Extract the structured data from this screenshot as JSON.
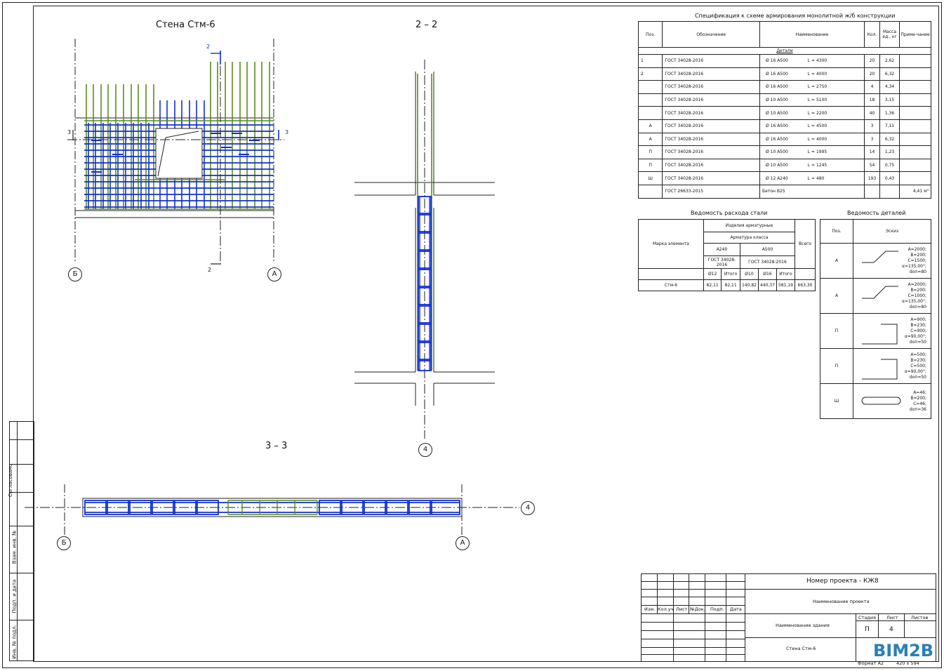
{
  "views": {
    "wall_title": "Стена Стм-6",
    "section22_title": "2 – 2",
    "section33_title": "3 – 3",
    "cut_label_2": "2",
    "cut_label_3": "3"
  },
  "axes": {
    "b": "Б",
    "a": "А",
    "four": "4"
  },
  "spec": {
    "title": "Спецификация к схеме армирования монолитной ж/б конструкции",
    "headers": [
      "Поз.",
      "Обозначение",
      "Наименование",
      "Кол.",
      "Масса ед., кг",
      "Приме-чание"
    ],
    "group": "Детали",
    "rows": [
      {
        "pos": "1",
        "doc": "ГОСТ 34028-2016",
        "name": "Ø 16 А500",
        "len": "L = 4300",
        "qty": "20",
        "mass": "2,62",
        "note": ""
      },
      {
        "pos": "2",
        "doc": "ГОСТ 34028-2016",
        "name": "Ø 16 А500",
        "len": "L = 4000",
        "qty": "20",
        "mass": "6,32",
        "note": ""
      },
      {
        "pos": "",
        "doc": "ГОСТ 34028-2016",
        "name": "Ø 16 А500",
        "len": "L = 2750",
        "qty": "4",
        "mass": "4,34",
        "note": ""
      },
      {
        "pos": "",
        "doc": "ГОСТ 34028-2016",
        "name": "Ø 10 А500",
        "len": "L = 5100",
        "qty": "18",
        "mass": "3,15",
        "note": ""
      },
      {
        "pos": "",
        "doc": "ГОСТ 34028-2016",
        "name": "Ø 10 А500",
        "len": "L = 2200",
        "qty": "40",
        "mass": "1,36",
        "note": ""
      },
      {
        "pos": "А",
        "doc": "ГОСТ 34028-2016",
        "name": "Ø 16 А500",
        "len": "L = 4500",
        "qty": "3",
        "mass": "7,11",
        "note": ""
      },
      {
        "pos": "А",
        "doc": "ГОСТ 34028-2016",
        "name": "Ø 16 А500",
        "len": "L = 4000",
        "qty": "3",
        "mass": "6,32",
        "note": ""
      },
      {
        "pos": "П",
        "doc": "ГОСТ 34028-2016",
        "name": "Ø 10 А500",
        "len": "L = 1995",
        "qty": "14",
        "mass": "1,23",
        "note": ""
      },
      {
        "pos": "П",
        "doc": "ГОСТ 34028-2016",
        "name": "Ø 10 А500",
        "len": "L = 1245",
        "qty": "54",
        "mass": "0,75",
        "note": ""
      },
      {
        "pos": "Ш",
        "doc": "ГОСТ 34028-2016",
        "name": "Ø 12 А240",
        "len": "L = 480",
        "qty": "193",
        "mass": "0,43",
        "note": ""
      },
      {
        "pos": "",
        "doc": "ГОСТ 26633-2015",
        "name": "Бетон В25",
        "len": "",
        "qty": "",
        "mass": "",
        "note": "4,41 м³"
      }
    ]
  },
  "ved_rashod": {
    "title": "Ведомость расхода стали",
    "col_element": "Марка элемента",
    "col_rebar": "Изделия арматурные",
    "col_class": "Арматура класса",
    "col_a240": "А240",
    "col_a500": "А500",
    "col_gost1": "ГОСТ 34028-2016",
    "col_gost2": "ГОСТ 34028-2016",
    "sub": [
      "Ø12",
      "Итого",
      "Ø10",
      "Ø16",
      "Итого"
    ],
    "col_total": "Всего",
    "row": {
      "name": "Стм-6",
      "v1": "82,11",
      "v2": "82,11",
      "v3": "140,82",
      "v4": "440,37",
      "v5": "581,19",
      "total": "663,30"
    }
  },
  "ved_detail": {
    "title": "Ведомость деталей",
    "col_pos": "Поз.",
    "col_sketch": "Эскиз",
    "rows": [
      {
        "pos": "А",
        "dims": [
          "А=2000;",
          "В=200;",
          "С=1500;",
          "α=135,00°;",
          "dоп=80"
        ]
      },
      {
        "pos": "А",
        "dims": [
          "А=2000;",
          "В=200;",
          "С=1000;",
          "α=135,00°;",
          "dоп=80"
        ]
      },
      {
        "pos": "П",
        "dims": [
          "А=900;",
          "В=230;",
          "С=900;",
          "α=90,00°;",
          "dоп=50"
        ]
      },
      {
        "pos": "П",
        "dims": [
          "А=500;",
          "В=230;",
          "С=500;",
          "α=90,00°;",
          "dоп=50"
        ]
      },
      {
        "pos": "Ш",
        "dims": [
          "А=46;",
          "В=200;",
          "С=46;",
          "dоп=36"
        ]
      }
    ]
  },
  "side_stamp": {
    "agreed": "Согласовано",
    "inv_subst": "Взам. инв. №",
    "sign_date": "Подп. и дата",
    "inv_orig": "Инв. № подл."
  },
  "stamp": {
    "project_number": "Номер проекта - КЖ8",
    "project_name": "Наименование проекта",
    "building_name": "Наименование здания",
    "sheet_name": "Стена Стм-6",
    "cols": [
      "Изм.",
      "Кол.уч",
      "Лист",
      "№Док.",
      "Подп.",
      "Дата"
    ],
    "stage_label": "Стадия",
    "sheet_label": "Лист",
    "sheets_label": "Листов",
    "stage": "П",
    "sheet": "4",
    "sheets": "",
    "logo": "BIM2B",
    "format_label": "Формат А2",
    "format_size": "420 x 594"
  },
  "colors": {
    "green": "#5a8a1e",
    "blue": "#1030d0",
    "line": "#222222"
  }
}
